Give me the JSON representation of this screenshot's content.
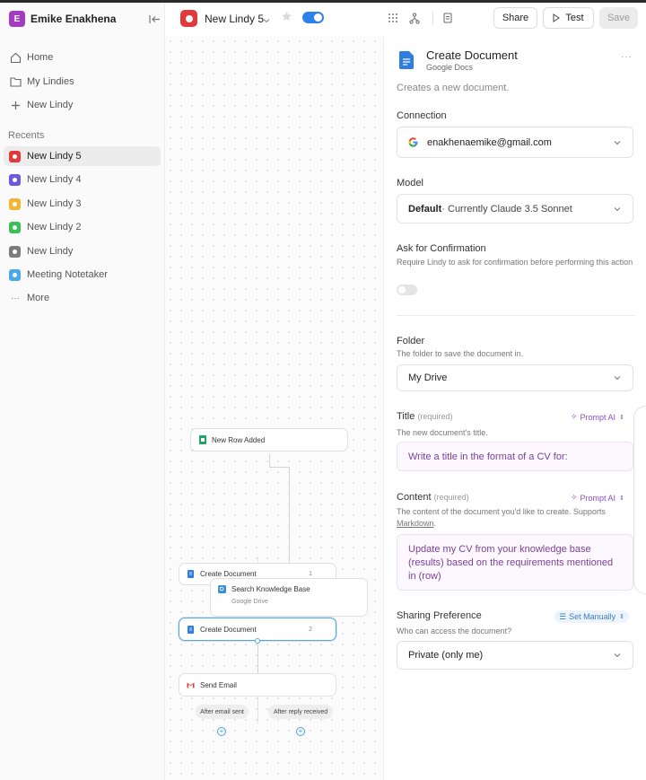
{
  "workspace": {
    "initial": "E",
    "name": "Emike Enakhena"
  },
  "nav": {
    "home": "Home",
    "my_lindies": "My Lindies",
    "new_lindy": "New Lindy"
  },
  "recents": {
    "label": "Recents",
    "items": [
      {
        "label": "New Lindy 5",
        "color": "#e23a3a"
      },
      {
        "label": "New Lindy 4",
        "color": "#6a5ae0"
      },
      {
        "label": "New Lindy 3",
        "color": "#f2b632"
      },
      {
        "label": "New Lindy 2",
        "color": "#3bbf5a"
      },
      {
        "label": "New Lindy",
        "color": "#7c7c7c"
      },
      {
        "label": "Meeting Notetaker",
        "color": "#4aa8e8"
      }
    ],
    "more": "More"
  },
  "topbar": {
    "title": "New Lindy 5",
    "share": "Share",
    "test": "Test",
    "save": "Save"
  },
  "canvas": {
    "trigger": "New Row Added",
    "node_create_1": "Create Document",
    "node_create_1_num": "1",
    "node_search": "Search Knowledge Base",
    "node_search_sub": "Google Drive",
    "node_create_2": "Create Document",
    "node_create_2_num": "2",
    "node_email": "Send Email",
    "branch_sent": "After email sent",
    "branch_reply": "After reply received"
  },
  "panel": {
    "title": "Create Document",
    "subtitle": "Google Docs",
    "description": "Creates a new document.",
    "connection": {
      "label": "Connection",
      "value": "enakhenaemike@gmail.com"
    },
    "model": {
      "label": "Model",
      "value_bold": "Default",
      "value_rest": " · Currently Claude 3.5 Sonnet"
    },
    "confirmation": {
      "label": "Ask for Confirmation",
      "hint": "Require Lindy to ask for confirmation before performing this action",
      "enabled": false
    },
    "folder": {
      "label": "Folder",
      "hint": "The folder to save the document in.",
      "value": "My Drive"
    },
    "title_field": {
      "label": "Title",
      "required": "(required)",
      "hint": "The new document's title.",
      "mode": "Prompt AI",
      "value": "Write a title in the format of a CV for:"
    },
    "content_field": {
      "label": "Content",
      "required": "(required)",
      "hint_pre": "The content of the document you'd like to create. Supports ",
      "hint_link": "Markdown",
      "hint_post": ".",
      "mode": "Prompt AI",
      "value": "Update my CV from your knowledge base (results) based on the requirements mentioned in (row)"
    },
    "sharing": {
      "label": "Sharing Preference",
      "hint": "Who can access the document?",
      "mode": "Set Manually",
      "value": "Private (only me)"
    }
  }
}
